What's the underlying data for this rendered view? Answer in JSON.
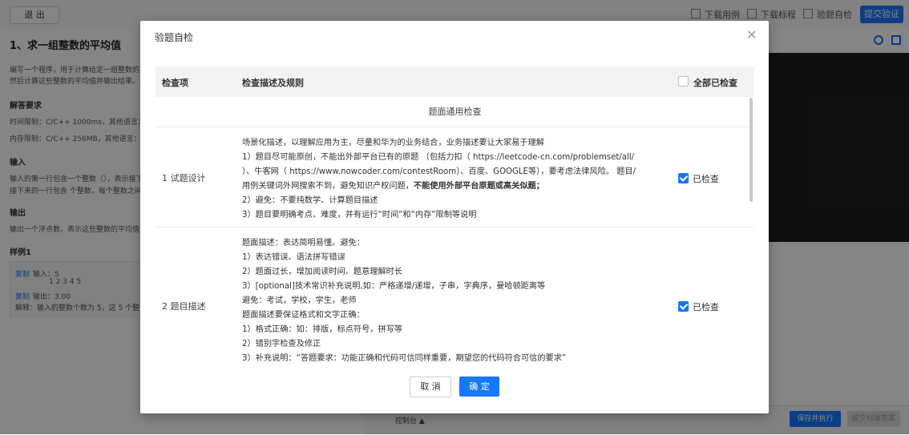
{
  "topbar": {
    "exit_label": "退 出",
    "download_cases": "下载用例",
    "download_standard": "下载标程",
    "self_check": "验题自检",
    "submit_label": "提交验证"
  },
  "problem": {
    "title": "1、求一组整数的平均值",
    "desc_line1": "编写一个程序，用于计算给定一组整数的平均",
    "desc_line2": "然后计算这些整数的平均值并输出结果。平均",
    "limits_head": "解答要求",
    "time_limit": "时间限制：C/C++ 1000ms，其他语言：2000",
    "mem_limit": "内存限制：C/C++ 256MB，其他语言：512M",
    "input_head": "输入",
    "input_line1": "输入的第一行包含一个整数（），表示接下",
    "input_line2": "接下来的一行包含 个整数，每个整数之间用",
    "output_head": "输出",
    "output_line1": "输出一个浮点数，表示这些整数的平均值，保",
    "example_head": "样例1",
    "copy_label": "复制",
    "input_label": "输入：5",
    "input_values": "1 2 3 4 5",
    "output_label": "输出：3.00",
    "explain": "解释：输入的整数个数为 5，这 5 个整数分别"
  },
  "console": {
    "label": "控制台 ▲",
    "save_run": "保存并执行",
    "submit_std": "提交标准答案"
  },
  "modal": {
    "title": "验题自检",
    "col_item": "检查项",
    "col_desc": "检查描述及规则",
    "all_checked": "全部已检查",
    "section": "题面通用检查",
    "rows": [
      {
        "item": "1 试题设计",
        "lines": [
          "场景化描述，以理解应用为主，尽量和华为的业务结合，业务描述要让大家易于理解",
          "1）题目尽可能原创，不能出外部平台已有的原题 （包括力扣（ https://leetcode-cn.com/problemset/all/",
          "）、牛客网（ https://www.nowcoder.com/contestRoom）、百度、GOOGLE等），要考虑法律风险。 题目/",
          "用例关键词外网搜索不到，避免知识产权问题，",
          "不能使用外部平台原题或高关似题；",
          "2）避免：不要纯数学、计算题目描述",
          "3）题目要明确考点、难度，并有运行“时间”和“内存”限制等说明"
        ],
        "status": "已检查"
      },
      {
        "item": "2 题目描述",
        "lines": [
          "题面描述：表达简明易懂。避免：",
          "1）表达错误、语法拼写错误",
          "2）题面过长，增加阅读时间、题意理解时长",
          "3）[optional]技术常识补充说明,如：严格递增/递增，子串，字典序，曼哈顿距离等",
          "避免：考试，学校，学生，老师",
          "题面描述要保证格式和文字正确：",
          "1）格式正确：如：排版，标点符号，拼写等",
          "2）错别字检查及修正",
          "3）补充说明：“答题要求：功能正确和代码可信同样重要，期望您的代码符合可信的要求”"
        ],
        "status": "已检查"
      }
    ],
    "cancel": "取 消",
    "ok": "确 定"
  },
  "colors": {
    "accent": "#1677ff"
  }
}
